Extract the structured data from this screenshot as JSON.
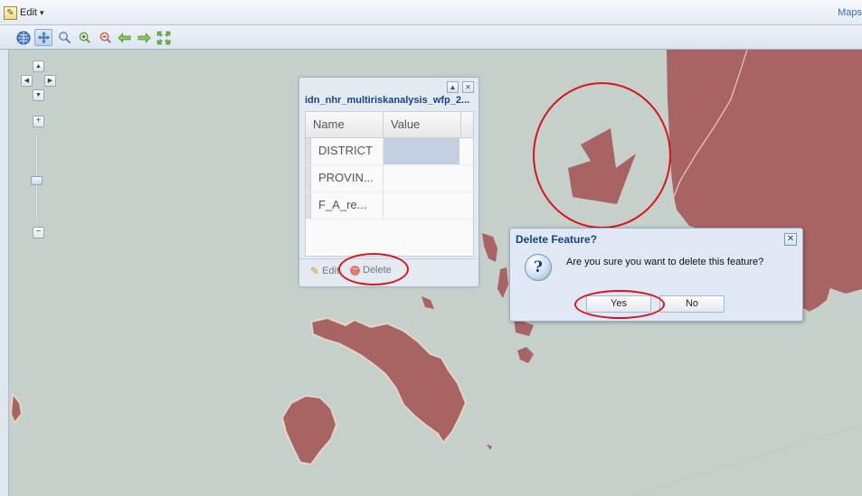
{
  "topbar": {
    "edit_label": "Edit",
    "edit_arrow": "▾",
    "maps_link": "Maps"
  },
  "toolbar": {
    "icons": [
      "globe-icon",
      "pan-icon",
      "zoom-box-icon",
      "zoom-in-icon",
      "zoom-out-icon",
      "back-icon",
      "forward-icon",
      "zoom-extent-icon"
    ]
  },
  "map_controls": {
    "pan_up": "▲",
    "pan_left": "◀",
    "pan_right": "▶",
    "pan_down": "▼",
    "zoom_in": "+",
    "zoom_out": "−"
  },
  "feature_popup": {
    "title": "idn_nhr_multiriskanalysis_wfp_2...",
    "columns": [
      "Name",
      "Value"
    ],
    "rows": [
      {
        "name": "DISTRICT",
        "value": ""
      },
      {
        "name": "PROVIN...",
        "value": ""
      },
      {
        "name": "F_A_re...",
        "value": ""
      }
    ],
    "edit_label": "Edit",
    "delete_label": "Delete",
    "collapse_icon": "▲",
    "close_icon": "✕"
  },
  "dialog": {
    "title": "Delete Feature?",
    "message": "Are you sure you want to delete this feature?",
    "icon_glyph": "?",
    "yes_label": "Yes",
    "no_label": "No",
    "close_icon": "✕"
  },
  "colors": {
    "land": "#a86462",
    "water": "#c5d0cb",
    "highlight": "#d9141b",
    "title_blue": "#15428b"
  }
}
